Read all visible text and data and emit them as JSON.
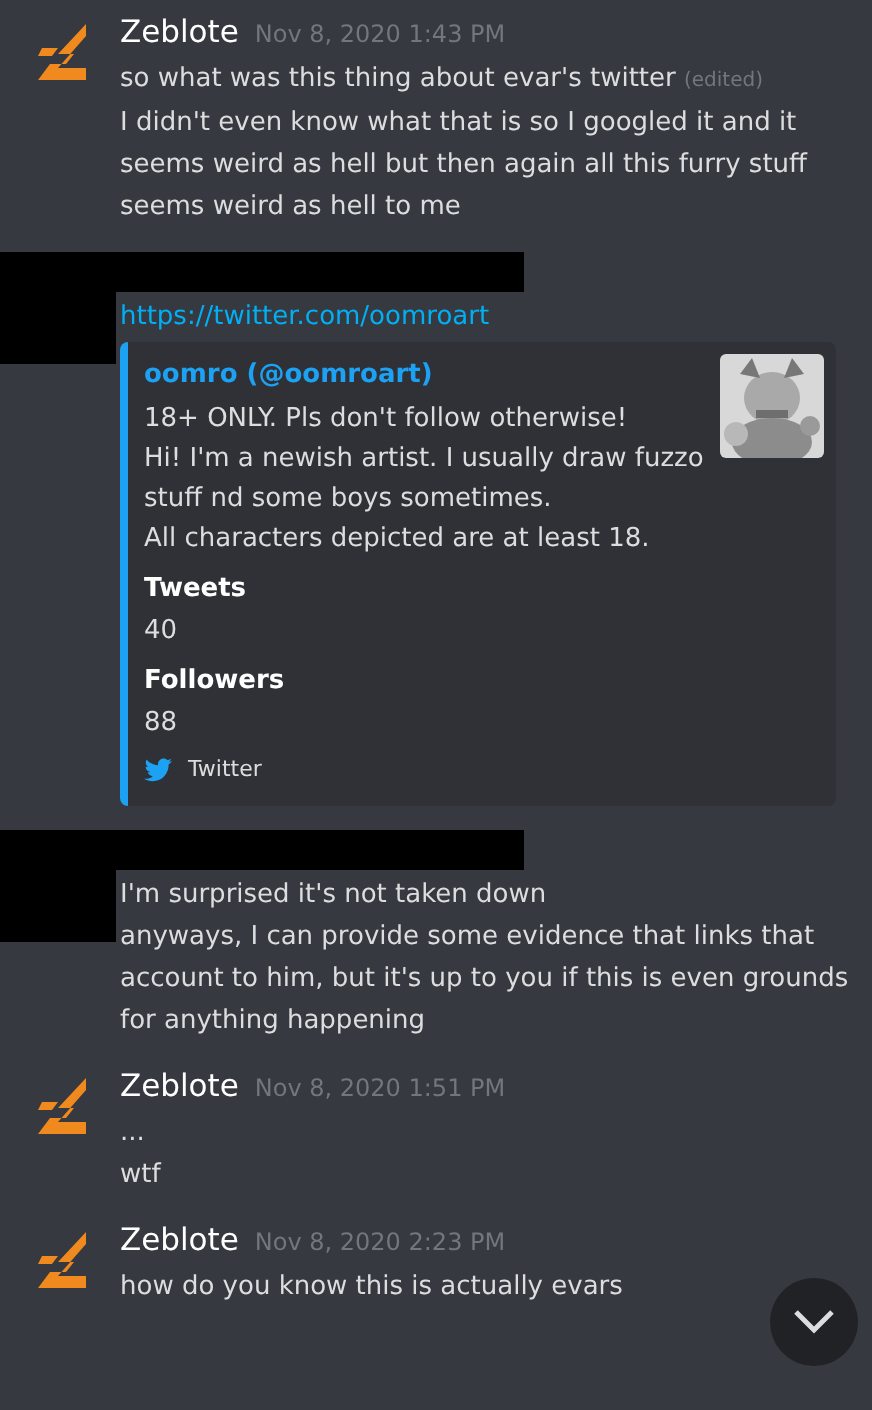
{
  "messages": [
    {
      "kind": "user",
      "author": "Zeblote",
      "time": "Nov 8, 2020 1:43 PM",
      "lines": [
        {
          "text": "so what was this thing about evar's twitter",
          "edited": "(edited)"
        },
        {
          "text": "I didn't even know what that is so I googled it and it seems weird as hell but then again all this furry stuff seems weird as hell to me"
        }
      ]
    },
    {
      "kind": "redacted",
      "link": "https://twitter.com/oomroart",
      "embed": {
        "author": "oomro (@oomroart)",
        "description": [
          "18+ ONLY. Pls don't follow otherwise!",
          "Hi! I'm a newish artist. I usually draw fuzzo stuff nd some boys sometimes.",
          "All characters depicted are at least 18."
        ],
        "fields": [
          {
            "name": "Tweets",
            "value": "40"
          },
          {
            "name": "Followers",
            "value": "88"
          }
        ],
        "footer": "Twitter"
      }
    },
    {
      "kind": "redacted",
      "lines": [
        {
          "text": "I'm surprised it's not taken down"
        },
        {
          "text": "anyways, I can provide some evidence that links that account to him, but it's up to you if this is even grounds for anything happening"
        }
      ]
    },
    {
      "kind": "user",
      "author": "Zeblote",
      "time": "Nov 8, 2020 1:51 PM",
      "lines": [
        {
          "text": "..."
        },
        {
          "text": "wtf"
        }
      ]
    },
    {
      "kind": "user",
      "author": "Zeblote",
      "time": "Nov 8, 2020 2:23 PM",
      "lines": [
        {
          "text": "how do you know this is actually evars"
        }
      ]
    }
  ]
}
